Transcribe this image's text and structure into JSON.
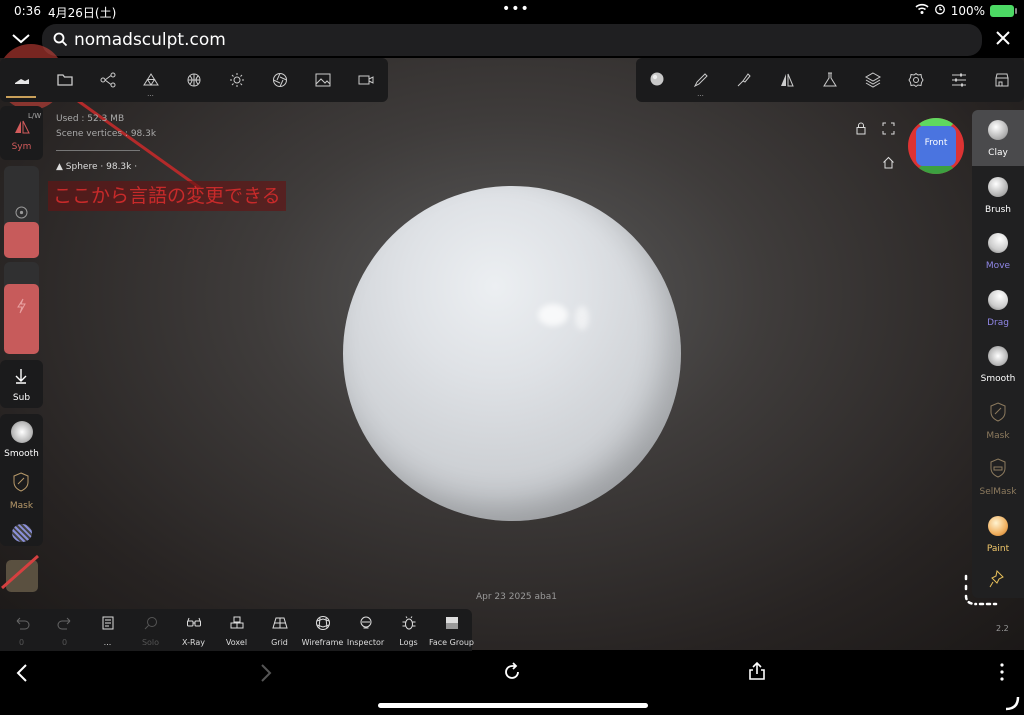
{
  "status": {
    "time": "0:36",
    "date": "4月26日(土)",
    "battery": "100%"
  },
  "url": {
    "text": "nomadsculpt.com"
  },
  "info": {
    "used": "Used : 52.3 MB",
    "vertices": "Scene vertices : 98.3k",
    "object_name": "Sphere",
    "object_verts": "· 98.3k ·"
  },
  "annotation": {
    "text": "ここから言語の変更できる"
  },
  "left": {
    "sym_tag": "L/W",
    "sym_label": "Sym",
    "sub_label": "Sub",
    "smooth_label": "Smooth",
    "mask_label": "Mask"
  },
  "gizmo": {
    "face": "Front"
  },
  "right_tools": [
    {
      "label": "Clay",
      "color": "#ffffff"
    },
    {
      "label": "Brush",
      "color": "#ffffff"
    },
    {
      "label": "Move",
      "color": "#8f86e6"
    },
    {
      "label": "Drag",
      "color": "#8f86e6"
    },
    {
      "label": "Smooth",
      "color": "#ffffff"
    },
    {
      "label": "Mask",
      "color": "#8c7a5e"
    },
    {
      "label": "SelMask",
      "color": "#8c7a5e"
    },
    {
      "label": "Paint",
      "color": "#f0c66a"
    }
  ],
  "bottom": {
    "undo_count": "0",
    "redo_count": "0",
    "history_dots": "...",
    "solo": "Solo",
    "xray": "X-Ray",
    "voxel": "Voxel",
    "grid": "Grid",
    "wireframe": "Wireframe",
    "inspector": "Inspector",
    "logs": "Logs",
    "face_group": "Face Group"
  },
  "datestamp": "Apr 23 2025 aba1",
  "version": "2.2",
  "accent_colors": {
    "active": "#c9a05a",
    "symmetry": "#d25b5b",
    "move": "#8f86e6"
  }
}
